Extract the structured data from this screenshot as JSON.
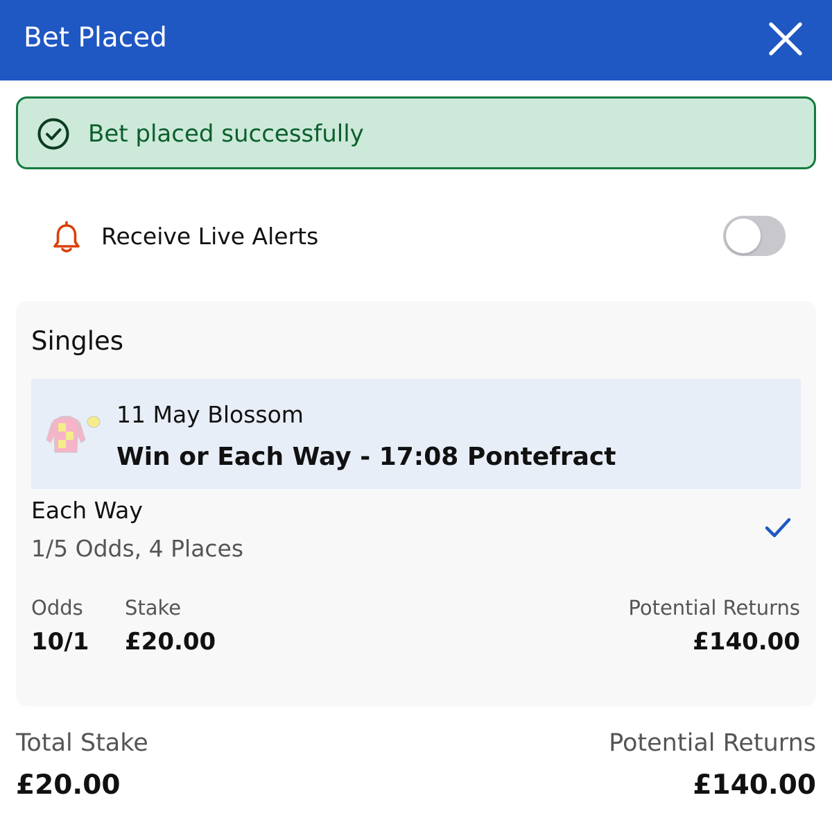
{
  "header": {
    "title": "Bet Placed",
    "close_icon": "close-icon",
    "background": "#1f57c3"
  },
  "banner": {
    "text": "Bet placed successfully",
    "icon": "check-circle-icon",
    "background": "#cde9da",
    "border": "#137a3d"
  },
  "alerts": {
    "label": "Receive Live Alerts",
    "icon": "bell-icon",
    "toggle_on": false
  },
  "singles": {
    "title": "Singles",
    "selection": {
      "name": "11 May Blossom",
      "market": "Win or Each Way - 17:08 Pontefract",
      "silks_icon": "jockey-silks-icon"
    },
    "each_way": {
      "label": "Each Way",
      "terms": "1/5 Odds, 4 Places",
      "checked": true
    },
    "odds": {
      "label": "Odds",
      "value": "10/1"
    },
    "stake": {
      "label": "Stake",
      "value": "£20.00"
    },
    "returns": {
      "label": "Potential Returns",
      "value": "£140.00"
    }
  },
  "totals": {
    "stake_label": "Total Stake",
    "stake_value": "£20.00",
    "returns_label": "Potential Returns",
    "returns_value": "£140.00"
  }
}
